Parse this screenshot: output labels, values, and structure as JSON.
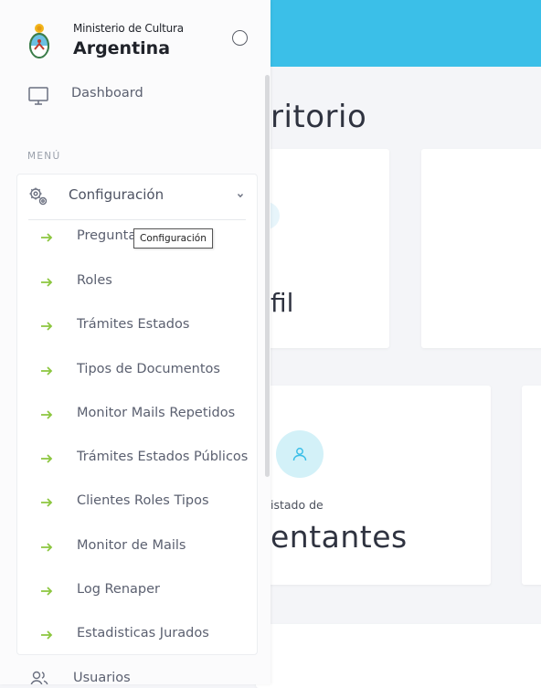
{
  "brand": {
    "small": "Ministerio de Cultura",
    "big": "Argentina"
  },
  "sidebar": {
    "dashboard_label": "Dashboard",
    "section_title": "MENÚ",
    "group": {
      "label": "Configuración",
      "tooltip": "Configuración",
      "items": [
        {
          "label": "Pregunta Encuesta"
        },
        {
          "label": "Roles"
        },
        {
          "label": "Trámites Estados"
        },
        {
          "label": "Tipos de Documentos"
        },
        {
          "label": "Monitor Mails Repetidos"
        },
        {
          "label": "Trámites Estados Públicos"
        },
        {
          "label": "Clientes Roles Tipos"
        },
        {
          "label": "Monitor de Mails"
        },
        {
          "label": "Log Renaper"
        },
        {
          "label": "Estadisticas Jurados"
        }
      ]
    },
    "usuarios_label": "Usuarios"
  },
  "main": {
    "page_title": "ritorio",
    "card1_title": "fil",
    "card3_subtitle": "istado de",
    "card3_title": "entantes"
  },
  "colors": {
    "topbar": "#3bbfe8",
    "arrow": "#8cc63f",
    "badge_bg": "#d3f1f8",
    "badge_icon": "#3bbfe8"
  },
  "icons": {
    "dashboard": "monitor-icon",
    "group": "gear-icon",
    "group_toggle": "chevron-down-icon",
    "sub_item": "arrow-right-icon",
    "usuarios": "users-icon",
    "brand": "coat-of-arms-icon",
    "card_badge": "user-icon"
  }
}
